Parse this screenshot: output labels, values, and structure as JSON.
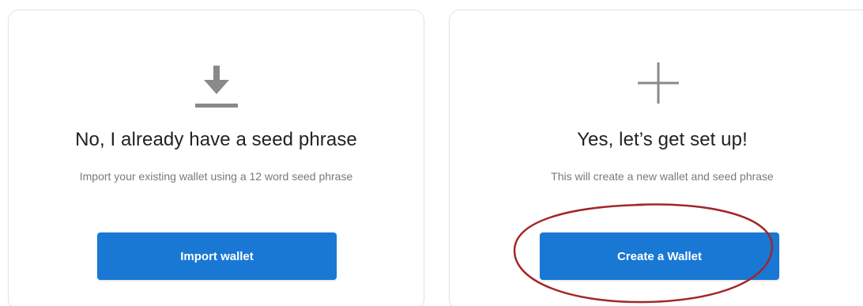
{
  "import_card": {
    "icon": "download-icon",
    "title": "No, I already have a seed phrase",
    "description": "Import your existing wallet using a 12 word seed phrase",
    "button_label": "Import wallet"
  },
  "create_card": {
    "icon": "plus-icon",
    "title": "Yes, let’s get set up!",
    "description": "This will create a new wallet and seed phrase",
    "button_label": "Create a Wallet"
  },
  "colors": {
    "button": "#1978d4",
    "icon": "#8a8a8a",
    "annotation": "#a3262a"
  }
}
